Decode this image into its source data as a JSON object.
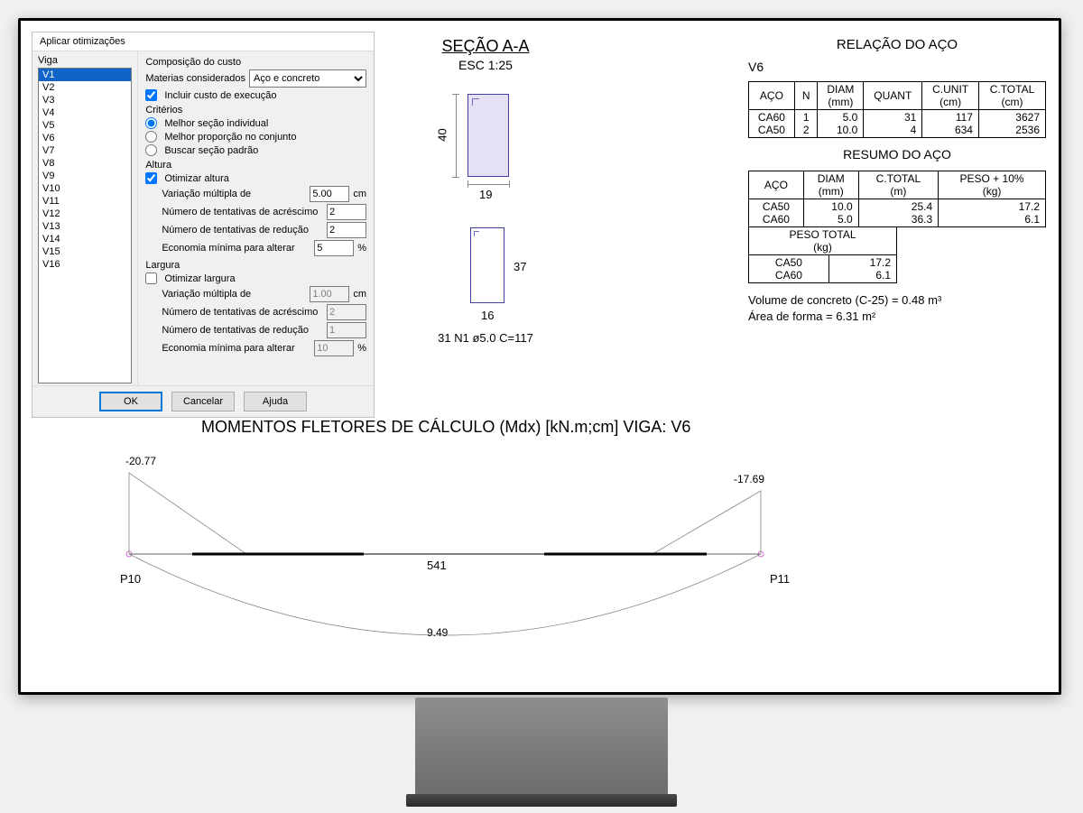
{
  "dialog": {
    "title": "Aplicar otimizações",
    "viga_header": "Viga",
    "vigas": [
      "V1",
      "V2",
      "V3",
      "V4",
      "V5",
      "V6",
      "V7",
      "V8",
      "V9",
      "V10",
      "V11",
      "V12",
      "V13",
      "V14",
      "V15",
      "V16"
    ],
    "selected_viga": "V1",
    "composicao_label": "Composição do custo",
    "materias_label": "Materias considerados",
    "materias_value": "Aço e concreto",
    "incluir_label": "Incluir custo de execução",
    "criterios_label": "Critérios",
    "radio1": "Melhor seção individual",
    "radio2": "Melhor proporção no conjunto",
    "radio3": "Buscar seção padrão",
    "altura_label": "Altura",
    "otimizar_altura": "Otimizar altura",
    "var_mult": "Variação múltipla de",
    "var_mult_alt_val": "5.00",
    "num_acr": "Número de tentativas de acréscimo",
    "num_acr_alt_val": "2",
    "num_red": "Número de tentativas de redução",
    "num_red_alt_val": "2",
    "econ_min": "Economia mínima para alterar",
    "econ_min_alt_val": "5",
    "largura_label": "Largura",
    "otimizar_largura": "Otimizar largura",
    "var_mult_lar_val": "1.00",
    "num_acr_lar_val": "2",
    "num_red_lar_val": "1",
    "econ_min_lar_val": "10",
    "unit_cm": "cm",
    "unit_pct": "%",
    "ok": "OK",
    "cancelar": "Cancelar",
    "ajuda": "Ajuda"
  },
  "section": {
    "title": "SEÇÃO A-A",
    "scale": "ESC 1:25",
    "dim_h_main": "40",
    "dim_w_main": "19",
    "dim_h_sub": "37",
    "dim_w_sub": "16",
    "rebar": "31 N1 ø5.0 C=117"
  },
  "steel": {
    "title": "RELAÇÃO DO AÇO",
    "beam": "V6",
    "t1_h1": "AÇO",
    "t1_h2": "N",
    "t1_h3": "DIAM\n(mm)",
    "t1_h4": "QUANT",
    "t1_h5": "C.UNIT\n(cm)",
    "t1_h6": "C.TOTAL\n(cm)",
    "t1_rows": [
      {
        "aco": "CA60",
        "n": "1",
        "diam": "5.0",
        "quant": "31",
        "cunit": "117",
        "ctotal": "3627"
      },
      {
        "aco": "CA50",
        "n": "2",
        "diam": "10.0",
        "quant": "4",
        "cunit": "634",
        "ctotal": "2536"
      }
    ],
    "resumo_title": "RESUMO DO AÇO",
    "t2_h1": "AÇO",
    "t2_h2": "DIAM\n(mm)",
    "t2_h3": "C.TOTAL\n(m)",
    "t2_h4": "PESO + 10%\n(kg)",
    "t2_rows": [
      {
        "aco": "CA50",
        "diam": "10.0",
        "ctotal": "25.4",
        "peso": "17.2"
      },
      {
        "aco": "CA60",
        "diam": "5.0",
        "ctotal": "36.3",
        "peso": "6.1"
      }
    ],
    "peso_total_label": "PESO TOTAL\n(kg)",
    "peso_rows": [
      {
        "aco": "CA50",
        "val": "17.2"
      },
      {
        "aco": "CA60",
        "val": "6.1"
      }
    ],
    "note1": "Volume de concreto (C-25) = 0.48 m³",
    "note2": "Área de forma = 6.31 m²"
  },
  "moment": {
    "title": "MOMENTOS FLETORES DE CÁLCULO (Mdx) [kN.m;cm]  VIGA: V6",
    "m_left": "-20.77",
    "m_right": "-17.69",
    "m_bottom": "9.49",
    "span": "541",
    "p_left": "P10",
    "p_right": "P11"
  }
}
